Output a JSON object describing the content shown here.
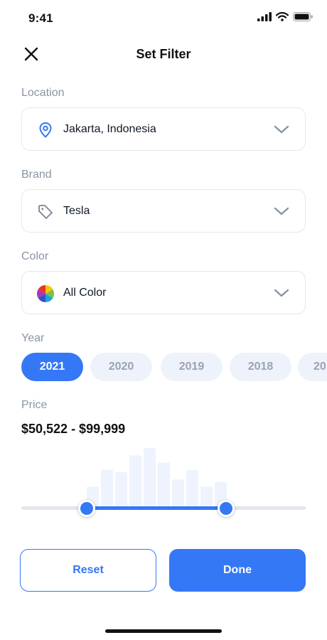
{
  "status_bar": {
    "time": "9:41"
  },
  "header": {
    "title": "Set Filter",
    "close_icon": "close-icon"
  },
  "location": {
    "label": "Location",
    "value": "Jakarta, Indonesia",
    "icon": "map-pin-icon"
  },
  "brand": {
    "label": "Brand",
    "value": "Tesla",
    "icon": "tag-icon"
  },
  "color": {
    "label": "Color",
    "value": "All Color",
    "icon": "color-wheel-icon"
  },
  "year": {
    "label": "Year",
    "options": [
      "2021",
      "2020",
      "2019",
      "2018",
      "20"
    ],
    "selected": "2021"
  },
  "price": {
    "label": "Price",
    "range_text": "$50,522 - $99,999",
    "distribution": [
      0.36,
      0.64,
      0.6,
      0.88,
      1.0,
      0.76,
      0.48,
      0.64,
      0.36,
      0.44
    ],
    "range_start_fraction": 0.23,
    "range_end_fraction": 0.72
  },
  "actions": {
    "reset_label": "Reset",
    "done_label": "Done"
  },
  "colors": {
    "accent": "#3478f6",
    "muted": "#8a94a6",
    "border": "#e3e7ed",
    "chip_bg": "#eef2fa",
    "bar": "#eef3fd"
  }
}
